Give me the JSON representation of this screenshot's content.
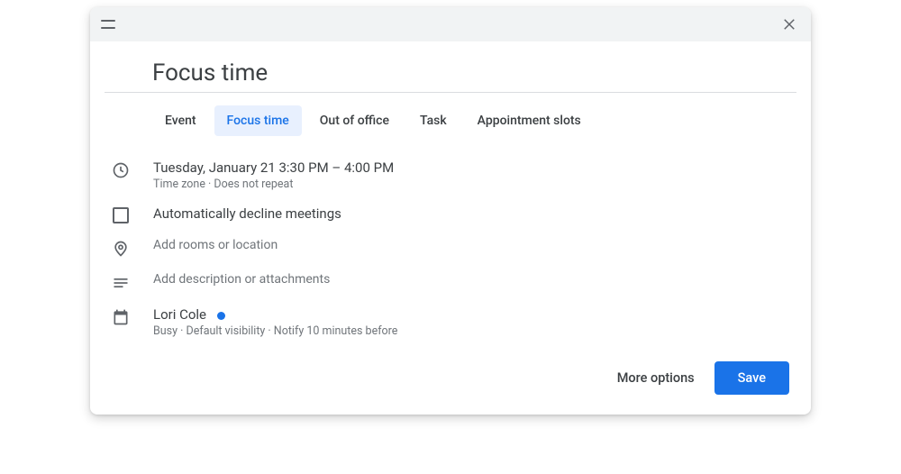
{
  "dialog": {
    "title": "Focus time"
  },
  "tabs": {
    "event": "Event",
    "focus_time": "Focus time",
    "out_of_office": "Out of office",
    "task": "Task",
    "appointment_slots": "Appointment slots"
  },
  "datetime": {
    "main": "Tuesday, January 21   3:30 PM – 4:00 PM",
    "sub": "Time zone · Does not repeat"
  },
  "decline": {
    "label": "Automatically decline meetings",
    "checked": false
  },
  "location": {
    "placeholder": "Add rooms or location"
  },
  "description": {
    "placeholder": "Add description or attachments"
  },
  "organizer": {
    "name": "Lori Cole",
    "status": "Busy · Default visibility · Notify 10 minutes before"
  },
  "actions": {
    "more_options": "More options",
    "save": "Save"
  }
}
